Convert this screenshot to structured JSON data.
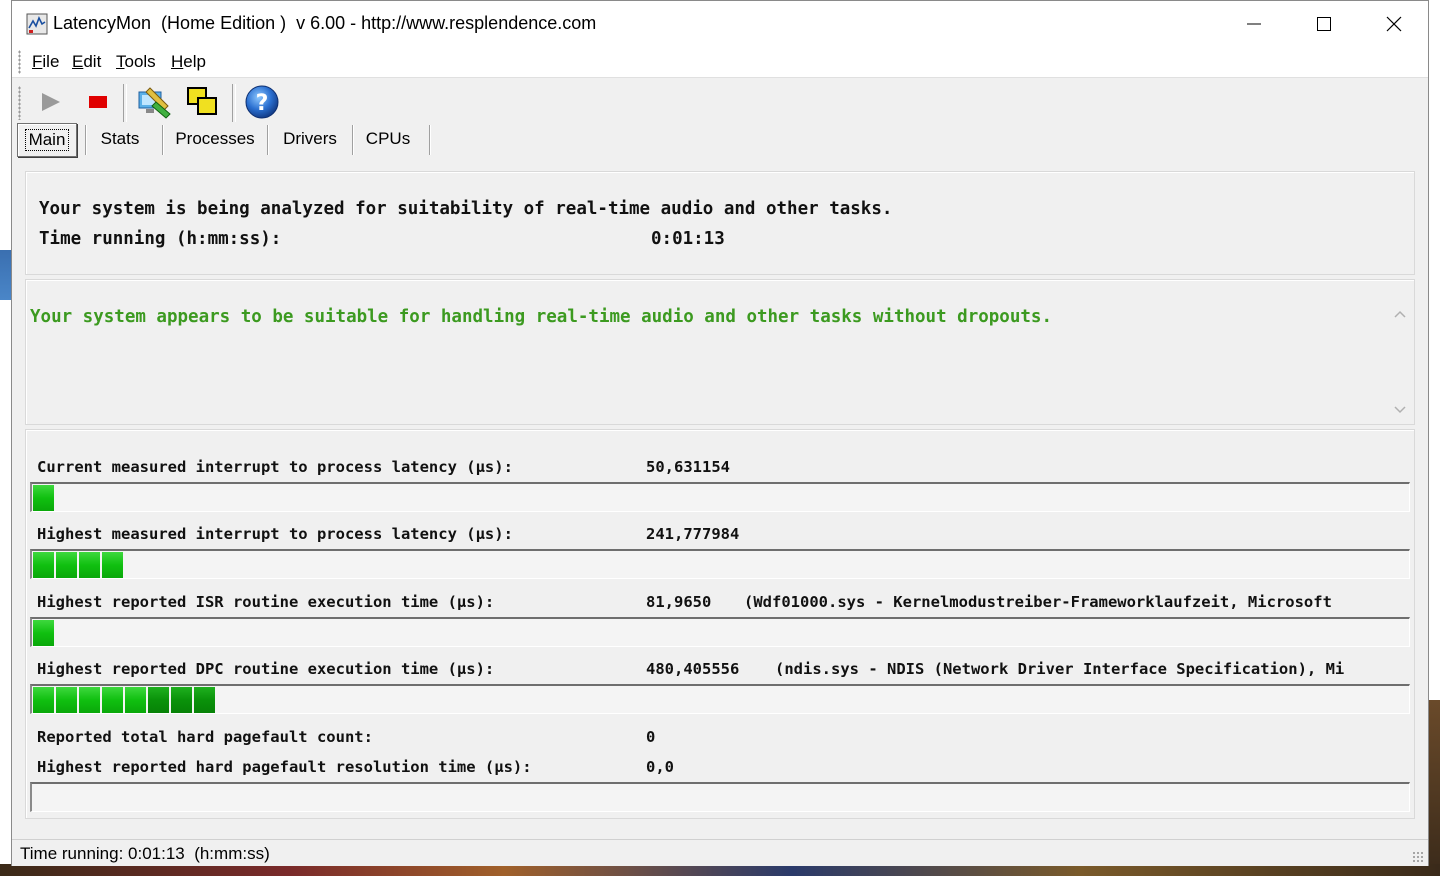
{
  "window": {
    "title": "LatencyMon  (Home Edition )  v 6.00 - http://www.resplendence.com"
  },
  "menu": [
    "File",
    "Edit",
    "Tools",
    "Help"
  ],
  "toolbar": {
    "icons": [
      "play-icon",
      "stop-icon",
      "analyze-icon",
      "windows-icon",
      "help-icon"
    ]
  },
  "tabs": [
    "Main",
    "Stats",
    "Processes",
    "Drivers",
    "CPUs"
  ],
  "main": {
    "analysis_line": "Your system is being analyzed for suitability of real-time audio and other tasks.",
    "time_label": "Time running (h:mm:ss):",
    "time_value": "0:01:13",
    "verdict": "Your system appears to be suitable for handling real-time audio and other tasks without dropouts."
  },
  "metrics": [
    {
      "label": "Current measured interrupt to process latency (µs):",
      "value": "50,631154",
      "extra": "",
      "bar_segments": 1
    },
    {
      "label": "Highest measured interrupt to process latency (µs):",
      "value": "241,777984",
      "extra": "",
      "bar_segments": 4
    },
    {
      "label": "Highest reported ISR routine execution time (µs):",
      "value": "81,9650",
      "extra": "(Wdf01000.sys - Kernelmodustreiber-Frameworklaufzeit, Microsoft",
      "bar_segments": 1
    },
    {
      "label": "Highest reported DPC routine execution time (µs):",
      "value": "480,405556",
      "extra": "(ndis.sys - NDIS (Network Driver Interface Specification), Mi",
      "bar_segments": 8
    },
    {
      "label": "Reported total hard pagefault count:",
      "value": "0",
      "extra": ""
    },
    {
      "label": "Highest reported hard pagefault resolution time (µs):",
      "value": "0,0",
      "extra": "",
      "bar_segments": 0
    }
  ],
  "status": {
    "text": "Time running: 0:01:13  (h:mm:ss)"
  },
  "colors": {
    "verdict_green": "#3c9a20",
    "bar_green": "#10c010",
    "stop_red": "#e00000"
  }
}
